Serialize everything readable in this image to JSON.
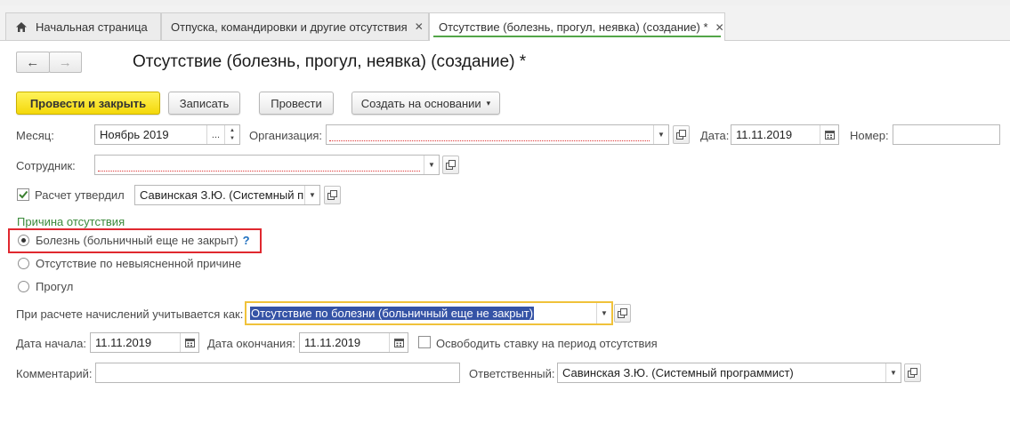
{
  "tabs": {
    "home_label": "Начальная страница",
    "tab1_label": "Отпуска, командировки и другие отсутствия",
    "tab2_label": "Отсутствие (болезнь, прогул, неявка) (создание) *",
    "close_glyph": "✕"
  },
  "form": {
    "title": "Отсутствие (болезнь, прогул, неявка) (создание) *",
    "back_glyph": "←",
    "forward_glyph": "→"
  },
  "toolbar": {
    "post_close_label": "Провести и закрыть",
    "save_label": "Записать",
    "post_label": "Провести",
    "create_based_label": "Создать на основании",
    "caret_glyph": "▾"
  },
  "fields": {
    "month_label": "Месяц:",
    "month_value": "Ноябрь 2019",
    "month_dots": "...",
    "org_label": "Организация:",
    "org_value": "",
    "date_label": "Дата:",
    "date_value": "11.11.2019",
    "number_label": "Номер:",
    "number_value": "",
    "employee_label": "Сотрудник:",
    "employee_value": "",
    "approved_label": "Расчет утвердил",
    "approved_checked": true,
    "approved_value": "Савинская З.Ю. (Системный п",
    "reason_section": "Причина отсутствия",
    "reason_options": [
      "Болезнь (больничный еще не закрыт)",
      "Отсутствие по невыясненной причине",
      "Прогул"
    ],
    "reason_selected": 0,
    "help_glyph": "?",
    "accounting_label": "При расчете начислений учитывается как:",
    "accounting_value": "Отсутствие по болезни (больничный еще не закрыт)",
    "start_label": "Дата начала:",
    "start_value": "11.11.2019",
    "end_label": "Дата окончания:",
    "end_value": "11.11.2019",
    "release_label": "Освободить ставку на период отсутствия",
    "release_checked": false,
    "comment_label": "Комментарий:",
    "comment_value": "",
    "responsible_label": "Ответственный:",
    "responsible_value": "Савинская З.Ю. (Системный программист)"
  },
  "colors": {
    "accent_green": "#53a548",
    "primary_yellow": "#f4d80a",
    "section_green": "#3b8a3b",
    "highlight_red": "#e0282f",
    "selection_blue": "#3553a6"
  }
}
